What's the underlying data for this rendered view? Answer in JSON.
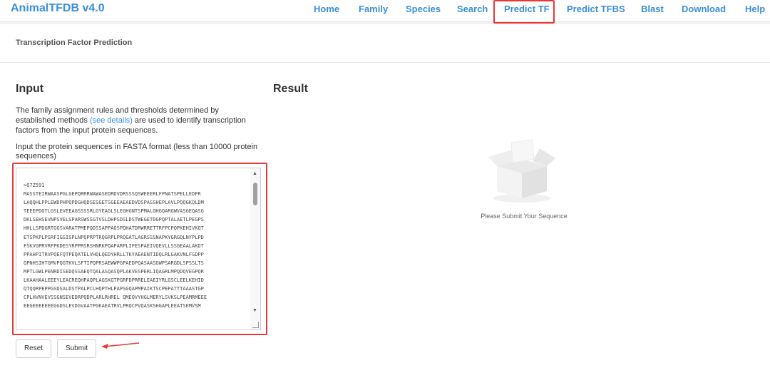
{
  "brand": "AnimalTFDB v4.0",
  "nav": [
    {
      "label": "Home"
    },
    {
      "label": "Family"
    },
    {
      "label": "Species"
    },
    {
      "label": "Search"
    },
    {
      "label": "Predict TF"
    },
    {
      "label": "Predict TFBS"
    },
    {
      "label": "Blast"
    },
    {
      "label": "Download"
    },
    {
      "label": "Help"
    }
  ],
  "page": {
    "title": "Transcription Factor Prediction"
  },
  "input": {
    "heading": "Input",
    "desc_before": "The family assignment rules and thresholds determined by established methods ",
    "desc_link": "(see details)",
    "desc_after": " are used to identify transcription factors from the input protein sequences.",
    "hint": "Input the protein sequences in FASTA format (less than 10000 protein sequences)",
    "sequence": ">Q7Z591\nMASSTEIRWAASPGLGEPQRRRWAWASEDRDVDRSSSQSWEEERLFPNATSPELLEDFR\nLAQQHLPPLEWDPHPQPDGHQDSESGETSGEEAEAEDVDSPASSHEPLAVLPQQGKQLDM\nTEEEPDGTLGSLEVEEAGSSSSRLGYEAGLSLEGHGNTSPMALGHGQARGWVASGEQASG\nDKLSEHSEVNPSVELSPARSWSSGTVSLDHPSDSLDSTWEGETDGPQPTALAETLPEGPS\nHHLLSPDGRTGGSVARATPMEPQDSSAPPAQSPQHATDRWRRETTRFPCPQPKEHIVKQT\nETSPKPLPSRFIGSISPLNPQPRPTRQGRPLPRQGATLAGRSSSNAPKYGRGQLNYPLPD\nFSKVGPRVRFPKDESYRPPRSRSHNRKPQAPARPLIFESPAEIVQEVLLSSGEAALAKDT\nPPAHPITRVPQEFQTPEQATELVHQLQEDYHRLLTKYAEAENTIDQLRLGAKVNLFSDPP\nQPNHSIHTGMVPQGTKVLSFTIPQPRSAEWWPGPAEDPQASAASGWPSARGDLSPSSLTS\nMPTLGWLPENRDISEDQSSAEQTQALASQASQPLAKVESPERLIQAGRLMPQDQVEGPQR\nLKAAHAALEEEYLEACREQHPAQPLAGSKGTPGRFDPRRELEAEIYRLGSCLEELKEHID\nQTQQRPEPPGSDSALDSTPALPCLHQPTHLPAPSGQAPMPAIKTSCPEPATTTAAASTGP\nCPLHVNVEVSSGNSEVEDRPQDPLARLRHREL QMEQVYHGLMERYLSVKSLPEAMRMEEE\nEEGEEEEEEEGGDSLEVDGVAATPGKAEATRVLPRQCPVQASKSHGAPLEEATSEMVSM"
  },
  "result": {
    "heading": "Result",
    "empty_text": "Please Submit Your Sequence"
  },
  "buttons": {
    "reset": "Reset",
    "submit": "Submit"
  },
  "colors": {
    "accent": "#3a8fd9",
    "highlight": "#e53935"
  }
}
